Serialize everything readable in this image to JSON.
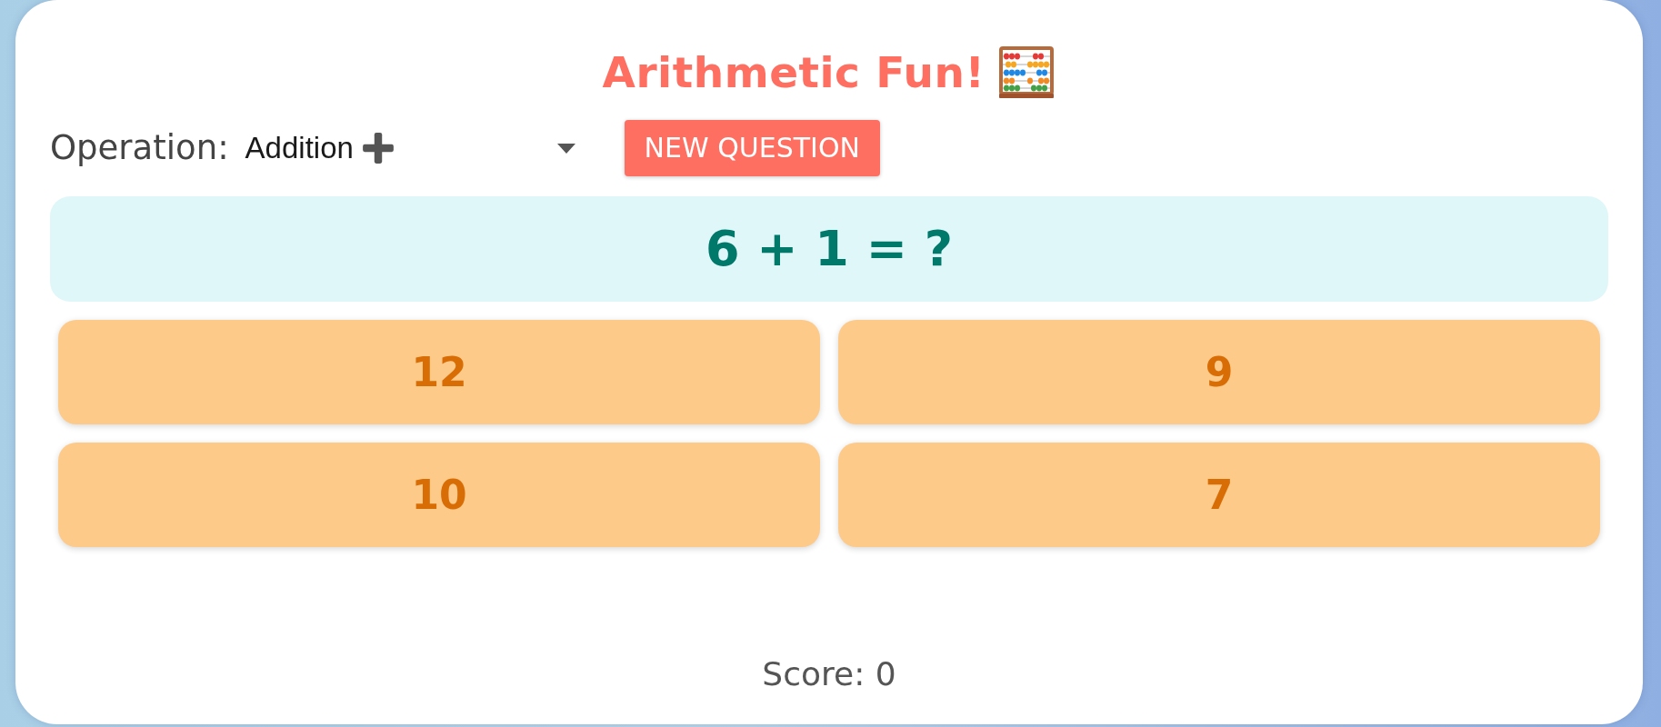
{
  "title": "Arithmetic Fun!",
  "operation": {
    "label": "Operation:",
    "value": "Addition"
  },
  "new_question_button": "NEW QUESTION",
  "question": "6 + 1 = ?",
  "answers": [
    "12",
    "9",
    "10",
    "7"
  ],
  "score": "Score: 0"
}
